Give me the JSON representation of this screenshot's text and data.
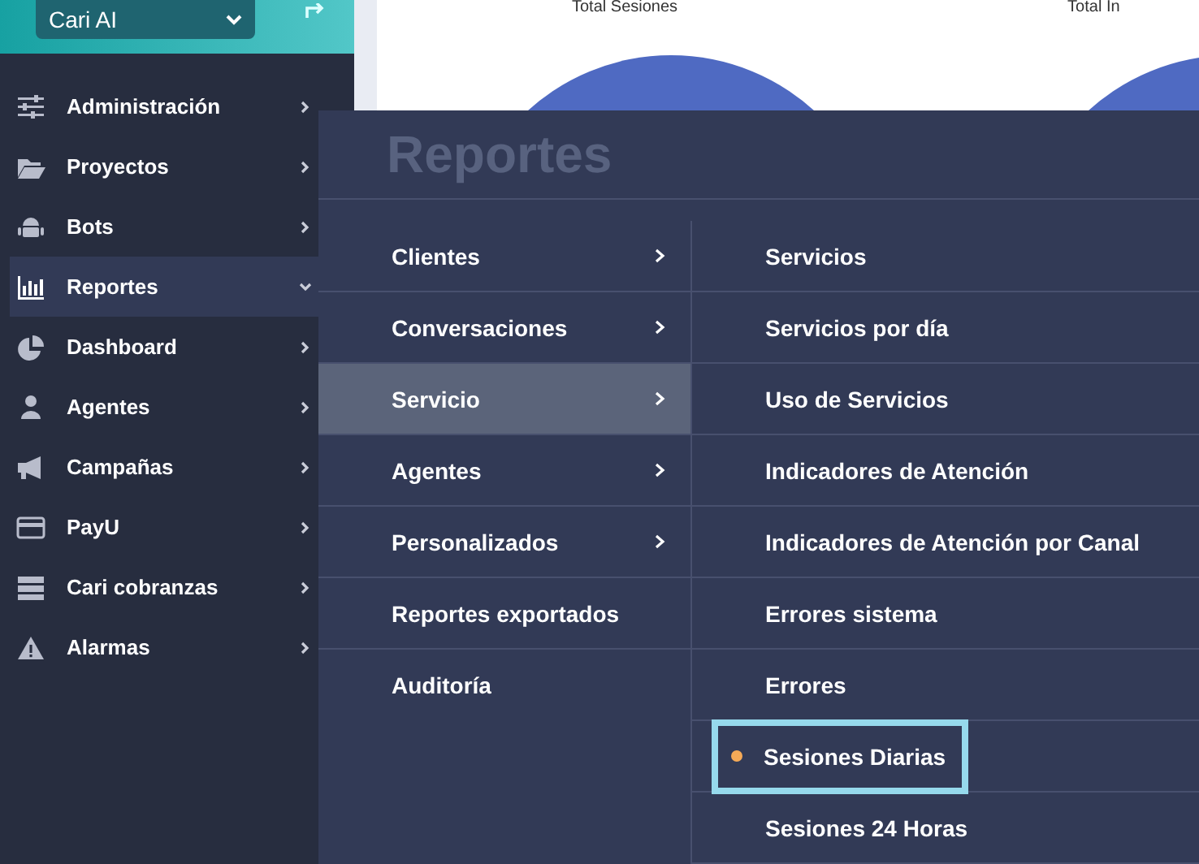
{
  "account_select": {
    "value": "Cari AI"
  },
  "background_cards": [
    {
      "title": "Total Sesiones"
    },
    {
      "title": "Total In"
    }
  ],
  "sidebar": {
    "items": [
      {
        "label": "Administración",
        "selected": false,
        "expanded": false
      },
      {
        "label": "Proyectos",
        "selected": false,
        "expanded": false
      },
      {
        "label": "Bots",
        "selected": false,
        "expanded": false
      },
      {
        "label": "Reportes",
        "selected": true,
        "expanded": true
      },
      {
        "label": "Dashboard",
        "selected": false,
        "expanded": false
      },
      {
        "label": "Agentes",
        "selected": false,
        "expanded": false
      },
      {
        "label": "Campañas",
        "selected": false,
        "expanded": false
      },
      {
        "label": "PayU",
        "selected": false,
        "expanded": false
      },
      {
        "label": "Cari cobranzas",
        "selected": false,
        "expanded": false
      },
      {
        "label": "Alarmas",
        "selected": false,
        "expanded": false
      }
    ]
  },
  "menu": {
    "title": "Reportes",
    "categories": [
      {
        "label": "Clientes",
        "has_submenu": true,
        "selected": false
      },
      {
        "label": "Conversaciones",
        "has_submenu": true,
        "selected": false
      },
      {
        "label": "Servicio",
        "has_submenu": true,
        "selected": true
      },
      {
        "label": "Agentes",
        "has_submenu": true,
        "selected": false
      },
      {
        "label": "Personalizados",
        "has_submenu": true,
        "selected": false
      },
      {
        "label": "Reportes exportados",
        "has_submenu": false,
        "selected": false
      },
      {
        "label": "Auditoría",
        "has_submenu": false,
        "selected": false
      }
    ],
    "reports": [
      {
        "label": "Servicios",
        "selected": false
      },
      {
        "label": "Servicios por día",
        "selected": false
      },
      {
        "label": "Uso de Servicios",
        "selected": false
      },
      {
        "label": "Indicadores de Atención",
        "selected": false
      },
      {
        "label": "Indicadores de Atención por Canal",
        "selected": false
      },
      {
        "label": "Errores sistema",
        "selected": false
      },
      {
        "label": "Errores",
        "selected": false
      },
      {
        "label": "Sesiones Diarias",
        "selected": true
      },
      {
        "label": "Sesiones 24 Horas",
        "selected": false
      }
    ]
  }
}
